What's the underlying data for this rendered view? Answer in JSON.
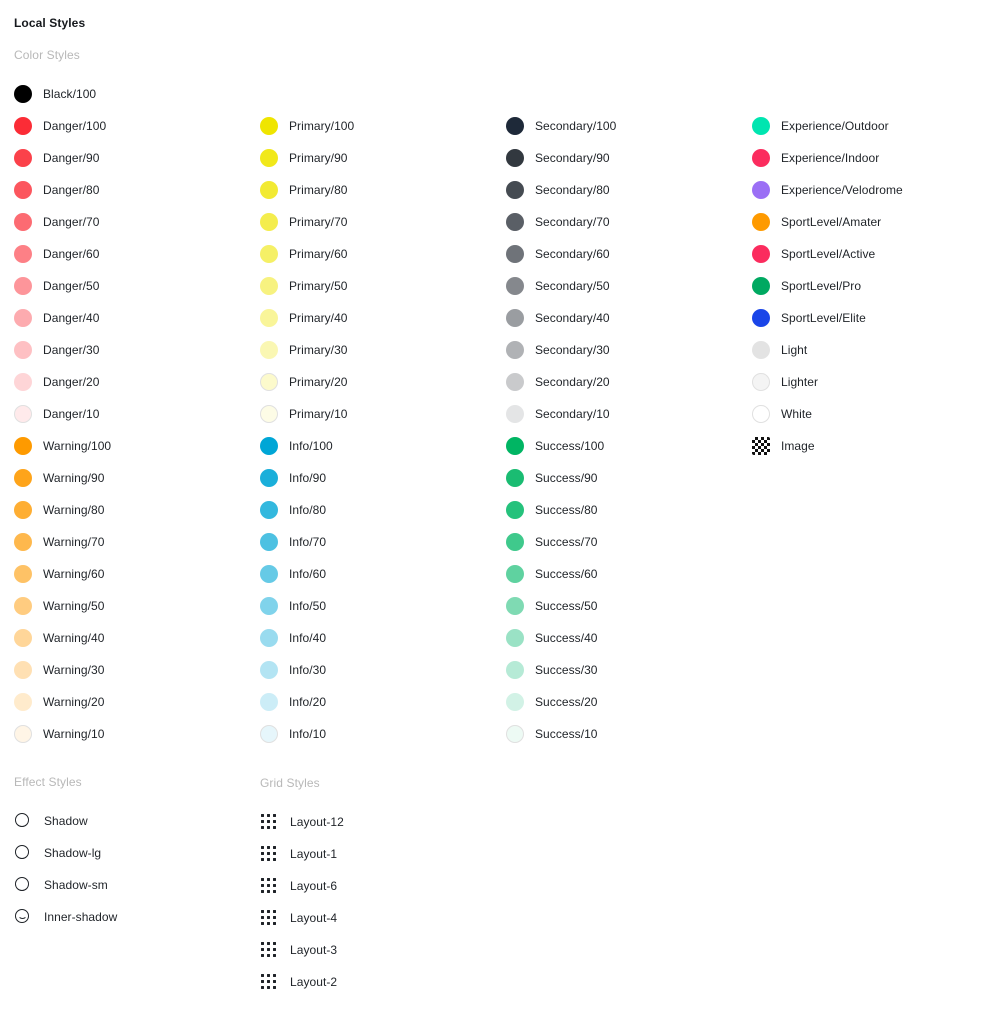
{
  "page": {
    "title": "Local Styles"
  },
  "sections": {
    "color_styles": "Color Styles",
    "effect_styles": "Effect Styles",
    "grid_styles": "Grid Styles"
  },
  "columns": [
    {
      "id": "column-1",
      "items": [
        {
          "name": "Black/100",
          "color": "#000000",
          "ring": false
        },
        {
          "name": "Danger/100",
          "color": "#FB2C36",
          "ring": false
        },
        {
          "name": "Danger/90",
          "color": "#FB414A",
          "ring": false
        },
        {
          "name": "Danger/80",
          "color": "#FC565E",
          "ring": false
        },
        {
          "name": "Danger/70",
          "color": "#FC6B72",
          "ring": false
        },
        {
          "name": "Danger/60",
          "color": "#FD8086",
          "ring": false
        },
        {
          "name": "Danger/50",
          "color": "#FD959A",
          "ring": false
        },
        {
          "name": "Danger/40",
          "color": "#FDABAF",
          "ring": false
        },
        {
          "name": "Danger/30",
          "color": "#FEC0C3",
          "ring": false
        },
        {
          "name": "Danger/20",
          "color": "#FED5D7",
          "ring": false
        },
        {
          "name": "Danger/10",
          "color": "#FFEAEB",
          "ring": true
        },
        {
          "name": "Warning/100",
          "color": "#FE9A00",
          "ring": false
        },
        {
          "name": "Warning/90",
          "color": "#FEA41A",
          "ring": false
        },
        {
          "name": "Warning/80",
          "color": "#FEAE33",
          "ring": false
        },
        {
          "name": "Warning/70",
          "color": "#FEB84D",
          "ring": false
        },
        {
          "name": "Warning/60",
          "color": "#FEC266",
          "ring": false
        },
        {
          "name": "Warning/50",
          "color": "#FFCC80",
          "ring": false
        },
        {
          "name": "Warning/40",
          "color": "#FFD699",
          "ring": false
        },
        {
          "name": "Warning/30",
          "color": "#FFE0B3",
          "ring": false
        },
        {
          "name": "Warning/20",
          "color": "#FFEBCC",
          "ring": false
        },
        {
          "name": "Warning/10",
          "color": "#FFF5E6",
          "ring": true
        }
      ]
    },
    {
      "id": "column-2",
      "items": [
        {
          "name": "Primary/100",
          "color": "#EFE500",
          "ring": false
        },
        {
          "name": "Primary/90",
          "color": "#F1E81A",
          "ring": false
        },
        {
          "name": "Primary/80",
          "color": "#F2EA33",
          "ring": false
        },
        {
          "name": "Primary/70",
          "color": "#F4ED4D",
          "ring": false
        },
        {
          "name": "Primary/60",
          "color": "#F5F066",
          "ring": false
        },
        {
          "name": "Primary/50",
          "color": "#F7F280",
          "ring": false
        },
        {
          "name": "Primary/40",
          "color": "#F9F599",
          "ring": false
        },
        {
          "name": "Primary/30",
          "color": "#FAF7B3",
          "ring": false
        },
        {
          "name": "Primary/20",
          "color": "#FCFACC",
          "ring": true
        },
        {
          "name": "Primary/10",
          "color": "#FDFCE6",
          "ring": true
        },
        {
          "name": "Info/100",
          "color": "#00A6D6",
          "ring": false
        },
        {
          "name": "Info/90",
          "color": "#1AAFDA",
          "ring": false
        },
        {
          "name": "Info/80",
          "color": "#33B8DE",
          "ring": false
        },
        {
          "name": "Info/70",
          "color": "#4DC1E2",
          "ring": false
        },
        {
          "name": "Info/60",
          "color": "#66CAE6",
          "ring": false
        },
        {
          "name": "Info/50",
          "color": "#80D3EB",
          "ring": false
        },
        {
          "name": "Info/40",
          "color": "#99DBEF",
          "ring": false
        },
        {
          "name": "Info/30",
          "color": "#B3E4F3",
          "ring": false
        },
        {
          "name": "Info/20",
          "color": "#CCEDF7",
          "ring": false
        },
        {
          "name": "Info/10",
          "color": "#E6F6FB",
          "ring": true
        }
      ]
    },
    {
      "id": "column-3",
      "items": [
        {
          "name": "Secondary/100",
          "color": "#1E2939",
          "ring": false
        },
        {
          "name": "Secondary/90",
          "color": "#32383F",
          "ring": false
        },
        {
          "name": "Secondary/80",
          "color": "#454B52",
          "ring": false
        },
        {
          "name": "Secondary/70",
          "color": "#5A5F66",
          "ring": false
        },
        {
          "name": "Secondary/60",
          "color": "#6F7379",
          "ring": false
        },
        {
          "name": "Secondary/50",
          "color": "#85888D",
          "ring": false
        },
        {
          "name": "Secondary/40",
          "color": "#9A9DA1",
          "ring": false
        },
        {
          "name": "Secondary/30",
          "color": "#B0B2B5",
          "ring": false
        },
        {
          "name": "Secondary/20",
          "color": "#C9CACC",
          "ring": false
        },
        {
          "name": "Secondary/10",
          "color": "#E4E5E6",
          "ring": false
        },
        {
          "name": "Success/100",
          "color": "#00B563",
          "ring": false
        },
        {
          "name": "Success/90",
          "color": "#1ABC72",
          "ring": false
        },
        {
          "name": "Success/80",
          "color": "#25C27C",
          "ring": false
        },
        {
          "name": "Success/70",
          "color": "#3FC98C",
          "ring": false
        },
        {
          "name": "Success/60",
          "color": "#5FD2A0",
          "ring": false
        },
        {
          "name": "Success/50",
          "color": "#7FDAB3",
          "ring": false
        },
        {
          "name": "Success/40",
          "color": "#9AE2C5",
          "ring": false
        },
        {
          "name": "Success/30",
          "color": "#B6EAD6",
          "ring": false
        },
        {
          "name": "Success/20",
          "color": "#D2F2E6",
          "ring": false
        },
        {
          "name": "Success/10",
          "color": "#EDFAF4",
          "ring": true
        }
      ]
    },
    {
      "id": "column-4",
      "items": [
        {
          "name": "Experience/Outdoor",
          "color": "#00E5B0",
          "ring": false
        },
        {
          "name": "Experience/Indoor",
          "color": "#FB2C5E",
          "ring": false
        },
        {
          "name": "Experience/Velodrome",
          "color": "#9B6FF5",
          "ring": false
        },
        {
          "name": "SportLevel/Amater",
          "color": "#FE9A00",
          "ring": false
        },
        {
          "name": "SportLevel/Active",
          "color": "#FB2C5E",
          "ring": false
        },
        {
          "name": "SportLevel/Pro",
          "color": "#00A961",
          "ring": false
        },
        {
          "name": "SportLevel/Elite",
          "color": "#1A45E8",
          "ring": false
        },
        {
          "name": "Light",
          "color": "#E3E3E3",
          "ring": false
        },
        {
          "name": "Lighter",
          "color": "#F4F4F4",
          "ring": true
        },
        {
          "name": "White",
          "color": "#FFFFFF",
          "ring": true
        },
        {
          "name": "Image",
          "color": "checker",
          "ring": false
        }
      ]
    }
  ],
  "effect_styles": [
    {
      "name": "Shadow",
      "icon": "shadow-icon"
    },
    {
      "name": "Shadow-lg",
      "icon": "shadow-icon"
    },
    {
      "name": "Shadow-sm",
      "icon": "shadow-icon"
    },
    {
      "name": "Inner-shadow",
      "icon": "inner-shadow-icon"
    }
  ],
  "grid_styles": [
    {
      "name": "Layout-12",
      "icon": "grid-icon"
    },
    {
      "name": "Layout-1",
      "icon": "grid-icon"
    },
    {
      "name": "Layout-6",
      "icon": "grid-icon"
    },
    {
      "name": "Layout-4",
      "icon": "grid-icon"
    },
    {
      "name": "Layout-3",
      "icon": "grid-icon"
    },
    {
      "name": "Layout-2",
      "icon": "grid-icon"
    }
  ]
}
